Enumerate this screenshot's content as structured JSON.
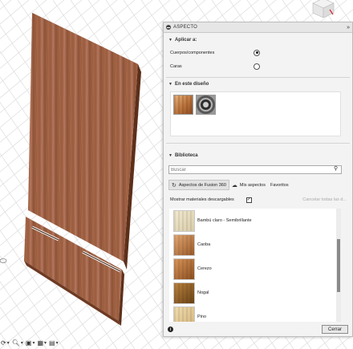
{
  "panel": {
    "title": "ASPECTO",
    "expand_icon": "double-chevron-right-icon"
  },
  "apply_to": {
    "heading": "Aplicar a:",
    "options": [
      {
        "label": "Cuerpos/componentes",
        "selected": true
      },
      {
        "label": "Caras",
        "selected": false
      }
    ]
  },
  "in_design": {
    "heading": "En este diseño",
    "swatches": [
      "wood-material-icon",
      "metal-material-icon"
    ]
  },
  "library": {
    "heading": "Biblioteca",
    "search_placeholder": "Buscar",
    "tabs": [
      {
        "label": "Aspectos de Fusion 360",
        "icon": "refresh-icon",
        "active": true
      },
      {
        "label": "Mis aspectos",
        "icon": "cloud-icon",
        "active": false
      },
      {
        "label": "Favoritos",
        "icon": "",
        "active": false
      }
    ],
    "show_downloadable_label": "Mostrar materiales descargables",
    "show_downloadable_checked": true,
    "cancel_all_label": "Cancelar todas las d...",
    "materials": [
      {
        "name": "Bambú claro - Semibrillante",
        "color_a": "#f1e9d0",
        "color_b": "#d9cca8"
      },
      {
        "name": "Caoba",
        "color_a": "#e2a772",
        "color_b": "#9a5a2a"
      },
      {
        "name": "Cerezo",
        "color_a": "#d9955a",
        "color_b": "#8c4f1f"
      },
      {
        "name": "Nogal",
        "color_a": "#b9813f",
        "color_b": "#6b4316"
      },
      {
        "name": "Pino",
        "color_a": "#f0dcae",
        "color_b": "#d4b57c"
      }
    ]
  },
  "footer": {
    "info_icon": "info-icon",
    "close_label": "Cerrar"
  },
  "colors": {
    "panel_bg": "#f3f3f3",
    "wood_panel": "#9a5a3a"
  }
}
